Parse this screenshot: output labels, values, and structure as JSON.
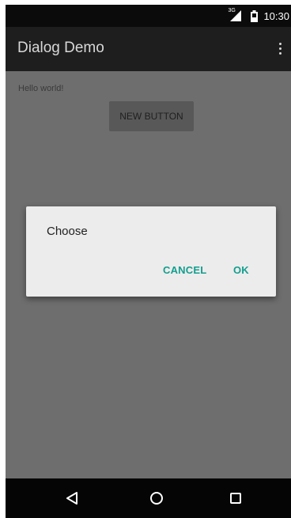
{
  "status_bar": {
    "network_type": "3G",
    "time": "10:30",
    "icons": [
      "signal-icon",
      "battery-icon"
    ]
  },
  "app_bar": {
    "title": "Dialog Demo",
    "menu_icon": "overflow-menu-icon"
  },
  "content": {
    "hello_text": "Hello world!",
    "new_button_label": "NEW BUTTON"
  },
  "dialog": {
    "message": "Choose",
    "cancel_label": "CANCEL",
    "ok_label": "OK",
    "accent_color": "#139e8e"
  },
  "nav_bar": {
    "icons": [
      "back-icon",
      "home-icon",
      "recents-icon"
    ]
  }
}
